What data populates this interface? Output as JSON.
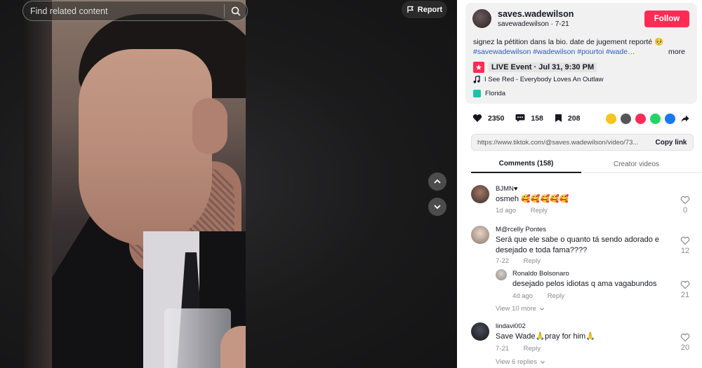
{
  "search": {
    "placeholder": "Find related content"
  },
  "report": {
    "label": "Report"
  },
  "author": {
    "display_name": "saves.wadewilson",
    "handle": "savewadewilson",
    "separator": " · ",
    "date": "7-21",
    "follow_label": "Follow"
  },
  "description": {
    "text": "signez la pétition dans la bio. date de jugement reporté 🥺",
    "hashtags": "#savewadewilson #wadewilson #pourtoi #wade…",
    "more_label": "more"
  },
  "live_event": {
    "label": "LIVE Event · Jul 31, 9:30 PM"
  },
  "music": {
    "title": "I See Red - Everybody Loves An Outlaw"
  },
  "location": {
    "name": "Florida"
  },
  "stats": {
    "likes": "2350",
    "comments": "158",
    "saves": "208"
  },
  "share_icons": [
    "repost-icon",
    "embed-icon",
    "send-icon",
    "whatsapp-icon",
    "facebook-icon",
    "share-arrow-icon"
  ],
  "link": {
    "url": "https://www.tiktok.com/@saves.wadewilson/video/73...",
    "copy_label": "Copy link"
  },
  "tabs": {
    "comments": "Comments (158)",
    "creator": "Creator videos"
  },
  "comments": [
    {
      "name": "BJMN♥",
      "text": "osmeh 🥰🥰🥰🥰🥰",
      "date": "1d ago",
      "reply": "Reply",
      "likes": "0"
    },
    {
      "name": "M@rcelly Pontes",
      "text": "Será que ele sabe o quanto tá sendo adorado e desejado e toda fama????",
      "date": "7-22",
      "reply": "Reply",
      "likes": "12",
      "replies": [
        {
          "name": "Ronaldo Bolsonaro",
          "text": "desejado pelos idiotas q ama vagabundos",
          "date": "4d ago",
          "reply": "Reply",
          "likes": "21"
        }
      ],
      "view_more": "View 10 more"
    },
    {
      "name": "lindavi002",
      "text": "Save Wade🙏pray for him🙏",
      "date": "7-21",
      "reply": "Reply",
      "likes": "20",
      "view_more": "View 6 replies"
    }
  ],
  "colors": {
    "accent": "#fe2c55",
    "hashtag": "#2b5db9",
    "muted": "#8a8b91"
  }
}
